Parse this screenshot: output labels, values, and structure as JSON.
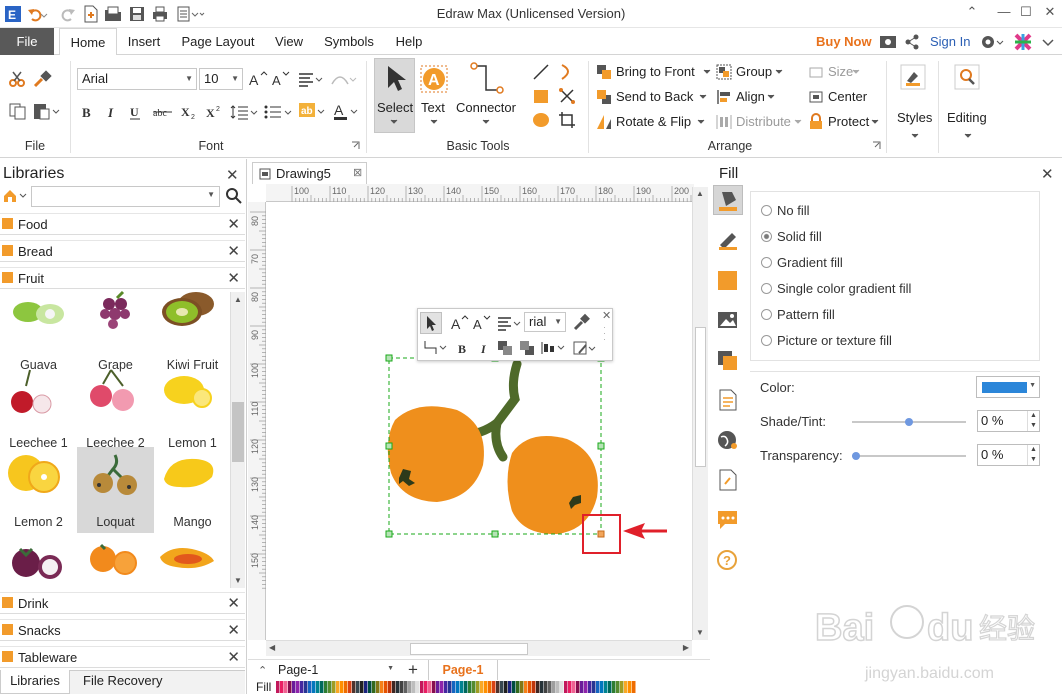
{
  "app": {
    "title": "Edraw Max (Unlicensed Version)"
  },
  "menu": {
    "file": "File",
    "tabs": [
      "Home",
      "Insert",
      "Page Layout",
      "View",
      "Symbols",
      "Help"
    ],
    "buy_now": "Buy Now",
    "sign_in": "Sign In"
  },
  "ribbon": {
    "file_group": "File",
    "font": {
      "name": "Arial",
      "size": "10",
      "group": "Font"
    },
    "tools": {
      "select": "Select",
      "text": "Text",
      "connector": "Connector",
      "group": "Basic Tools"
    },
    "arrange": {
      "bring_to_front": "Bring to Front",
      "send_to_back": "Send to Back",
      "rotate_flip": "Rotate & Flip",
      "group_btn": "Group",
      "align": "Align",
      "distribute": "Distribute",
      "size": "Size",
      "center": "Center",
      "protect": "Protect",
      "group": "Arrange"
    },
    "styles": "Styles",
    "editing": "Editing"
  },
  "libraries": {
    "title": "Libraries",
    "categories_top": [
      "Food",
      "Bread",
      "Fruit"
    ],
    "fruits": [
      {
        "label": "Guava"
      },
      {
        "label": "Grape"
      },
      {
        "label": "Kiwi Fruit"
      },
      {
        "label": "Leechee 1"
      },
      {
        "label": "Leechee 2"
      },
      {
        "label": "Lemon 1"
      },
      {
        "label": "Lemon 2"
      },
      {
        "label": "Loquat",
        "selected": true
      },
      {
        "label": "Mango"
      },
      {
        "label": ""
      },
      {
        "label": ""
      },
      {
        "label": ""
      }
    ],
    "categories_bottom": [
      "Drink",
      "Snacks",
      "Tableware"
    ],
    "tabs": [
      "Libraries",
      "File Recovery"
    ]
  },
  "document": {
    "tab": "Drawing5",
    "ruler_top": [
      "100",
      "110",
      "120",
      "130",
      "140",
      "150",
      "160",
      "170",
      "180",
      "190",
      "200"
    ],
    "ruler_left": [
      "80",
      "70",
      "80",
      "90",
      "100",
      "110",
      "120",
      "130",
      "140",
      "150"
    ],
    "floatbar_font": "rial",
    "page_select": "Page-1",
    "page_tab": "Page-1",
    "fill_label": "Fill"
  },
  "fill_panel": {
    "title": "Fill",
    "options": [
      "No fill",
      "Solid fill",
      "Gradient fill",
      "Single color gradient fill",
      "Pattern fill",
      "Picture or texture fill"
    ],
    "selected": "Solid fill",
    "color_label": "Color:",
    "color_value": "#2b86d9",
    "shade_label": "Shade/Tint:",
    "shade_value": "0 %",
    "shade_level": 0.5,
    "transparency_label": "Transparency:",
    "transparency_value": "0 %",
    "transparency_level": 0
  },
  "colors": {
    "accent": "#e8721c",
    "loquat": "#ef8f1c",
    "stem": "#4f6a2a",
    "selection": "#1aa81a"
  }
}
